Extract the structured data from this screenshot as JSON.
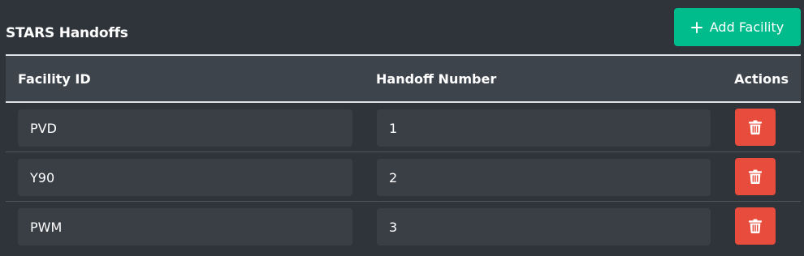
{
  "section": {
    "title": "STARS Handoffs"
  },
  "toolbar": {
    "add_label": "Add Facility",
    "add_icon": "plus-icon"
  },
  "table": {
    "headers": {
      "facility_id": "Facility ID",
      "handoff_number": "Handoff Number",
      "actions": "Actions"
    },
    "rows": [
      {
        "facility_id": "PVD",
        "handoff_number": "1"
      },
      {
        "facility_id": "Y90",
        "handoff_number": "2"
      },
      {
        "facility_id": "PWM",
        "handoff_number": "3"
      }
    ],
    "delete_icon": "trash-icon"
  },
  "colors": {
    "background": "#2f343a",
    "header_background": "#3e444c",
    "input_background": "#3a3f46",
    "add_button": "#00bc8c",
    "delete_button": "#e74c3c"
  }
}
